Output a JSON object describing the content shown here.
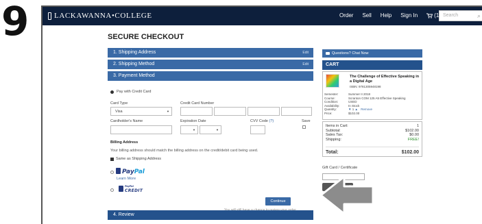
{
  "step_number": "9",
  "header": {
    "brand": "LACKAWANNA•COLLEGE",
    "nav": [
      "Order",
      "Sell",
      "Help",
      "Sign In"
    ],
    "cart_count": "(1)",
    "search_placeholder": "Search"
  },
  "page_title": "SECURE CHECKOUT",
  "steps": {
    "shipping_address": "1. Shipping Address",
    "shipping_method": "2. Shipping Method",
    "payment_method": "3. Payment Method",
    "review": "4. Review",
    "edit": "Edit"
  },
  "payment": {
    "pay_with_credit_card": "Pay with Credit Card",
    "card_type_label": "Card Type",
    "card_type_value": "Visa",
    "card_number_label": "Credit Card Number",
    "cardholder_label": "Cardholder's Name",
    "expiration_label": "Expiration Date",
    "cvv_label": "CVV Code",
    "cvv_help": "(?)",
    "save_label": "Save",
    "billing_title": "Billing Address",
    "billing_note": "Your billing address should match the billing address on the credit/debit card being used.",
    "same_as_shipping": "Same as Shipping Address",
    "paypal_pay": "Pay",
    "paypal_pal": "Pal",
    "learn_more": "Learn More",
    "paypal_credit_small": "PayPal",
    "paypal_credit_big": "CREDIT",
    "continue": "Continue",
    "review_note": "You will still have a chance to review your order."
  },
  "sidebar": {
    "chat": "Questions? Chat Now",
    "cart_title": "CART",
    "book_title": "The Challenge of Effective Speaking in a Digital Age",
    "isbn": "ISBN: 9781305948198",
    "meta": [
      {
        "k": "Semester:",
        "v": "Summer II 2018"
      },
      {
        "k": "Course:",
        "v": "Scranton COM 125 A5 Effective Speaking"
      },
      {
        "k": "Condition:",
        "v": "USED"
      },
      {
        "k": "Availability:",
        "v": "In Stock"
      },
      {
        "k": "Quantity:",
        "v": "1"
      },
      {
        "k": "Price:",
        "v": "$102.00"
      }
    ],
    "remove": "Remove",
    "totals": {
      "items_label": "Items in Cart:",
      "items_value": "1",
      "subtotal_label": "Subtotal:",
      "subtotal_value": "$102.00",
      "tax_label": "Sales Tax:",
      "tax_value": "$0.00",
      "shipping_label": "Shipping:",
      "shipping_value": "FREE!",
      "total_label": "Total:",
      "total_value": "$102.00"
    },
    "gift_label": "Gift Card / Certificate",
    "gift_button": "ard"
  }
}
